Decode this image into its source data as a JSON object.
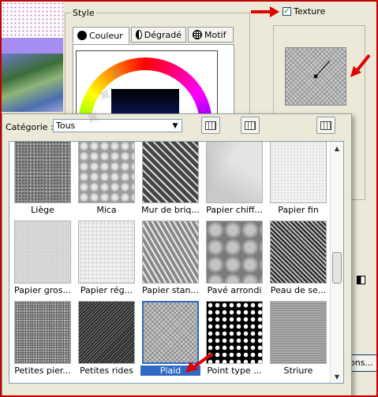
{
  "style_group": {
    "label": "Style",
    "tabs": [
      {
        "label": "Couleur",
        "icon": "black-circle-icon"
      },
      {
        "label": "Dégradé",
        "icon": "half-circle-icon"
      },
      {
        "label": "Motif",
        "icon": "pattern-globe-icon"
      }
    ]
  },
  "texture": {
    "label": "Texture",
    "checked": true
  },
  "options_button": "ons...",
  "popup": {
    "category_label": "Catégorie :",
    "category_value": "Tous",
    "textures": [
      {
        "label": "Liège"
      },
      {
        "label": "Mica"
      },
      {
        "label": "Mur de briq..."
      },
      {
        "label": "Papier chiff..."
      },
      {
        "label": "Papier fin"
      },
      {
        "label": "Papier gros..."
      },
      {
        "label": "Papier rég..."
      },
      {
        "label": "Papier stan..."
      },
      {
        "label": "Pavé arrondi"
      },
      {
        "label": "Peau de se..."
      },
      {
        "label": "Petites pier..."
      },
      {
        "label": "Petites rides"
      },
      {
        "label": "Plaid",
        "selected": true
      },
      {
        "label": "Point type ..."
      },
      {
        "label": "Striure"
      }
    ]
  },
  "colors": {
    "selection": "#316ac5",
    "annotation_arrow": "#e00000",
    "frame_border": "#c00000"
  }
}
